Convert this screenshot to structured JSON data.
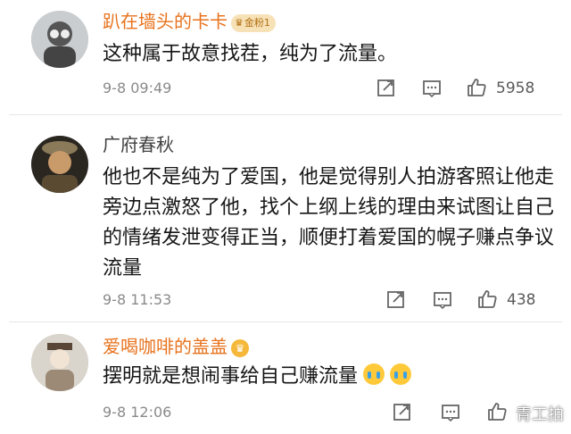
{
  "comments": [
    {
      "author": "趴在墙头的卡卡",
      "badge": "金粉1",
      "text": "这种属于故意找茬，纯为了流量。",
      "time": "9-8 09:49",
      "likes": "5958"
    },
    {
      "author": "广府春秋",
      "text": "他也不是纯为了爱国，他是觉得别人拍游客照让他走旁边点激怒了他，找个上纲上线的理由来试图让自己的情绪发泄变得正当，顺便打着爱国的幌子赚点争议流量",
      "time": "9-8 11:53",
      "likes": "438"
    },
    {
      "author": "爱喝咖啡的盖盖",
      "text": "摆明就是想闹事给自己赚流量",
      "time": "9-8 12:06",
      "likes": ""
    }
  ],
  "watermark": "青工拍",
  "colors": {
    "vip_name": "#e8721c",
    "name": "#404040",
    "meta": "#8a8a8a",
    "divider": "#e6e6e6"
  },
  "icons": [
    "share-icon",
    "reply-icon",
    "like-icon",
    "crown-icon",
    "crying-emoji-icon"
  ]
}
